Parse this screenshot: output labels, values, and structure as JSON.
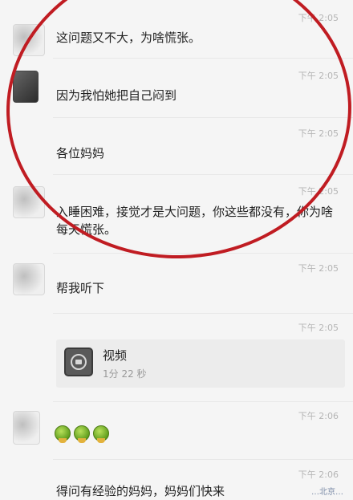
{
  "messages": [
    {
      "time": "下午 2:05",
      "text": "这问题又不大，为啥慌张。"
    },
    {
      "time": "下午 2:05",
      "text": "因为我怕她把自己闷到"
    },
    {
      "time": "下午 2:05",
      "text": "各位妈妈"
    },
    {
      "time": "下午 2:05",
      "text": "入睡困难，接觉才是大问题，你这些都没有，你为啥每天慌张。"
    },
    {
      "time": "下午 2:05",
      "text": "帮我听下"
    },
    {
      "time": "下午 2:05"
    },
    {
      "time": "下午 2:06"
    },
    {
      "time": "下午 2:06",
      "text": "得问有经验的妈妈，妈妈们快来"
    }
  ],
  "video": {
    "title": "视频",
    "duration": "1分 22 秒",
    "icon": "video-play-icon"
  },
  "emoji": {
    "count": 3,
    "icon": "green-frog-emoji-icon"
  },
  "watermark": "…北京…"
}
